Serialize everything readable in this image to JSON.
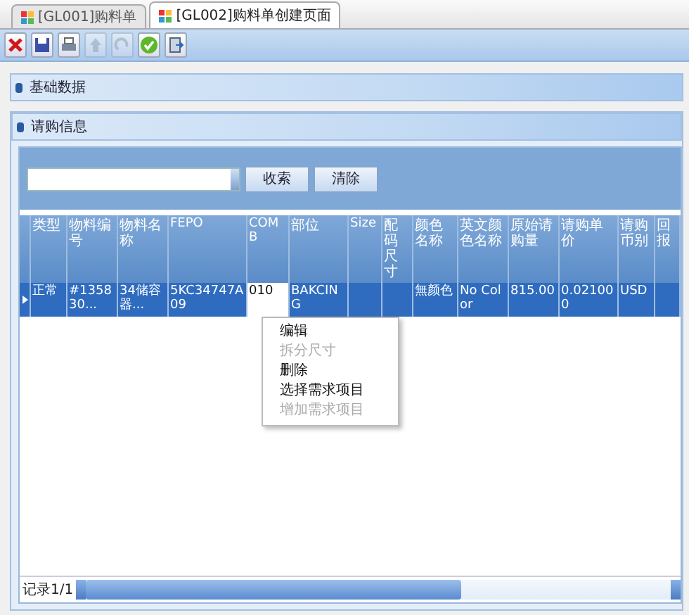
{
  "tabs": [
    {
      "label": "[GL001]购料单",
      "selected": false
    },
    {
      "label": "[GL002]购料单创建页面",
      "selected": true
    }
  ],
  "toolbar": [
    {
      "kind": "close",
      "disabled": false
    },
    {
      "kind": "save",
      "disabled": false
    },
    {
      "kind": "print",
      "disabled": false
    },
    {
      "kind": "up",
      "disabled": true
    },
    {
      "kind": "redo",
      "disabled": true
    },
    {
      "kind": "confirm",
      "disabled": false
    },
    {
      "kind": "exit",
      "disabled": false
    }
  ],
  "panels": [
    {
      "title": "基础数据"
    },
    {
      "title": "请购信息"
    }
  ],
  "search": {
    "buttons": [
      "收索",
      "清除"
    ]
  },
  "table": {
    "columns": [
      "类型",
      "物料编号",
      "物料名称",
      "FEPO",
      "COMB",
      "部位",
      "Size",
      "配码尺寸",
      "颜色名称",
      "英文颜色名称",
      "原始请购量",
      "请购单价",
      "请购币别",
      "回报"
    ],
    "rows": [
      {
        "selected": true,
        "cells": [
          {
            "text": "正常",
            "editing": false
          },
          {
            "text": "#135830...",
            "editing": false
          },
          {
            "text": "34储容器...",
            "editing": false
          },
          {
            "text": "5KC34747A09",
            "editing": false
          },
          {
            "text": "010",
            "editing": true
          },
          {
            "text": "BAKCING",
            "editing": false
          },
          {
            "editing": false
          },
          {
            "editing": false
          },
          {
            "text": "無颜色",
            "editing": false
          },
          {
            "text": "No Color",
            "editing": false
          },
          {
            "text": "815.00",
            "editing": false
          },
          {
            "text": "0.021000",
            "editing": false
          },
          {
            "text": "USD",
            "editing": false
          },
          {
            "editing": false
          }
        ]
      }
    ]
  },
  "context_menu": [
    {
      "label": "编辑",
      "disabled": false
    },
    {
      "label": "拆分尺寸",
      "disabled": true
    },
    {
      "label": "删除",
      "disabled": false
    },
    {
      "label": "选择需求项目",
      "disabled": false
    },
    {
      "label": "增加需求项目",
      "disabled": true
    }
  ],
  "footer": {
    "record": "记录1/1"
  }
}
